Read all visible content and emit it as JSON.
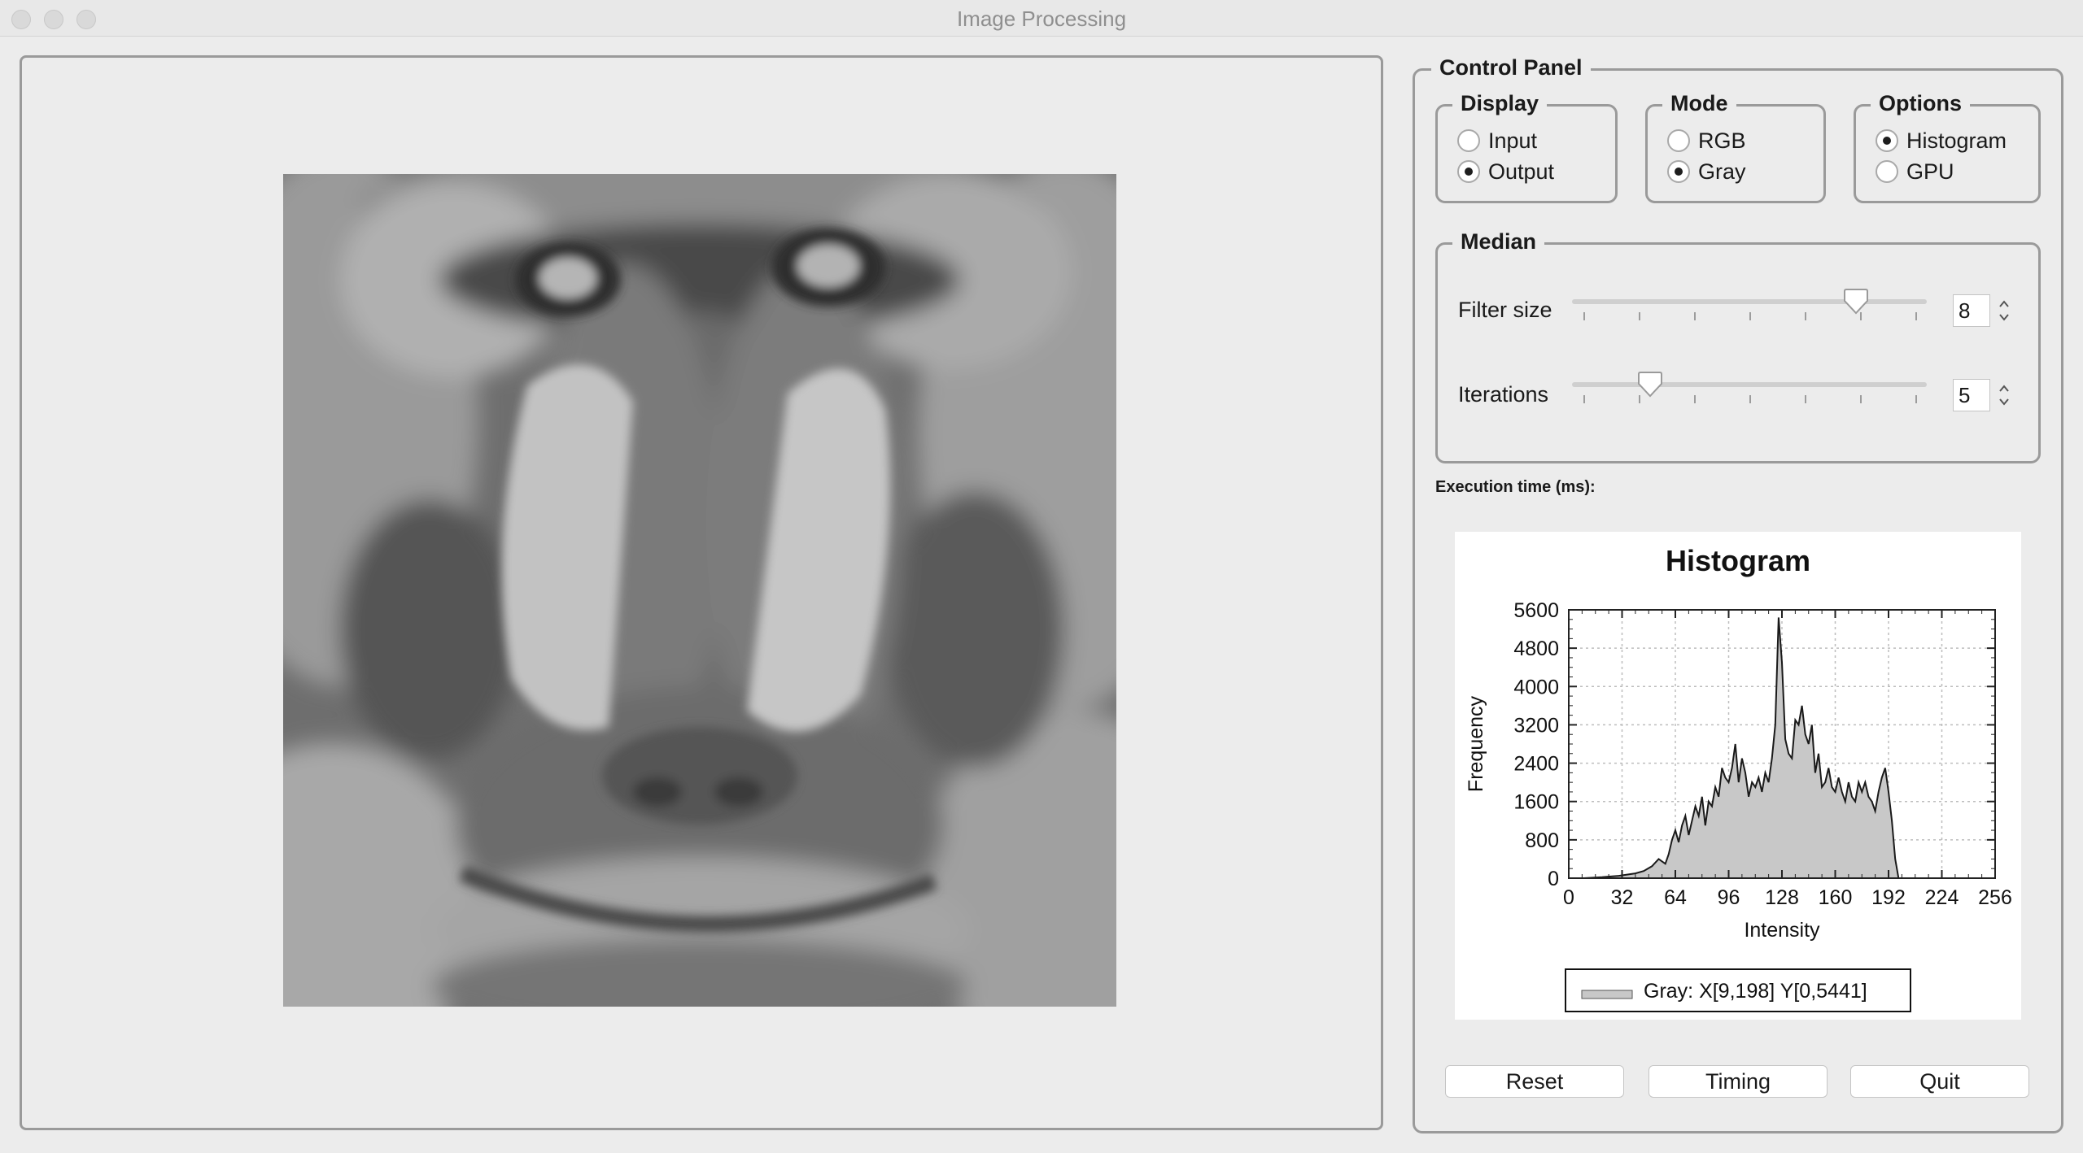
{
  "window": {
    "title": "Image Processing"
  },
  "control_panel": {
    "title": "Control Panel",
    "display": {
      "title": "Display",
      "options": [
        "Input",
        "Output"
      ],
      "selected": "Output"
    },
    "mode": {
      "title": "Mode",
      "options": [
        "RGB",
        "Gray"
      ],
      "selected": "Gray"
    },
    "options": {
      "title": "Options",
      "items": [
        "Histogram",
        "GPU"
      ],
      "selected": "Histogram"
    },
    "median": {
      "title": "Median",
      "filter_size": {
        "label": "Filter size",
        "value": "8",
        "position": 0.8
      },
      "iterations": {
        "label": "Iterations",
        "value": "5",
        "position": 0.22
      }
    },
    "execution_time_label": "Execution time (ms):"
  },
  "chart_data": {
    "type": "area",
    "title": "Histogram",
    "xlabel": "Intensity",
    "ylabel": "Frequency",
    "xlim": [
      0,
      256
    ],
    "ylim": [
      0,
      5600
    ],
    "xticks": [
      "0",
      "32",
      "64",
      "96",
      "128",
      "160",
      "192",
      "224",
      "256"
    ],
    "yticks": [
      "0",
      "800",
      "1600",
      "2400",
      "3200",
      "4000",
      "4800",
      "5600"
    ],
    "grid": true,
    "legend": {
      "position": "bottom",
      "text": "Gray: X[9,198] Y[0,5441]"
    },
    "series": [
      {
        "name": "Gray",
        "x": [
          9,
          20,
          30,
          40,
          45,
          50,
          54,
          58,
          60,
          62,
          64,
          66,
          68,
          70,
          72,
          74,
          76,
          78,
          80,
          82,
          84,
          86,
          88,
          90,
          92,
          94,
          96,
          98,
          100,
          102,
          104,
          106,
          108,
          110,
          112,
          114,
          116,
          118,
          120,
          122,
          124,
          126,
          128,
          130,
          132,
          134,
          136,
          138,
          140,
          142,
          144,
          146,
          148,
          150,
          152,
          154,
          156,
          158,
          160,
          162,
          164,
          166,
          168,
          170,
          172,
          174,
          176,
          178,
          180,
          182,
          184,
          186,
          188,
          190,
          192,
          194,
          196,
          198
        ],
        "y": [
          0,
          20,
          50,
          100,
          150,
          250,
          400,
          300,
          500,
          800,
          1000,
          750,
          1100,
          1300,
          900,
          1200,
          1500,
          1300,
          1700,
          1100,
          1600,
          1500,
          1900,
          1700,
          2300,
          2100,
          2000,
          2300,
          2800,
          2000,
          2500,
          2200,
          1700,
          2000,
          1900,
          2100,
          1800,
          2200,
          2000,
          2500,
          3200,
          5441,
          4500,
          2900,
          2600,
          2500,
          3300,
          3200,
          3600,
          3000,
          2800,
          3200,
          2200,
          2600,
          1900,
          2000,
          2300,
          1900,
          1800,
          2100,
          1800,
          1600,
          2000,
          1700,
          1600,
          2000,
          1800,
          2000,
          1700,
          1600,
          1400,
          1800,
          2100,
          2300,
          1800,
          1200,
          400,
          0
        ]
      }
    ]
  },
  "buttons": {
    "reset": "Reset",
    "timing": "Timing",
    "quit": "Quit"
  }
}
